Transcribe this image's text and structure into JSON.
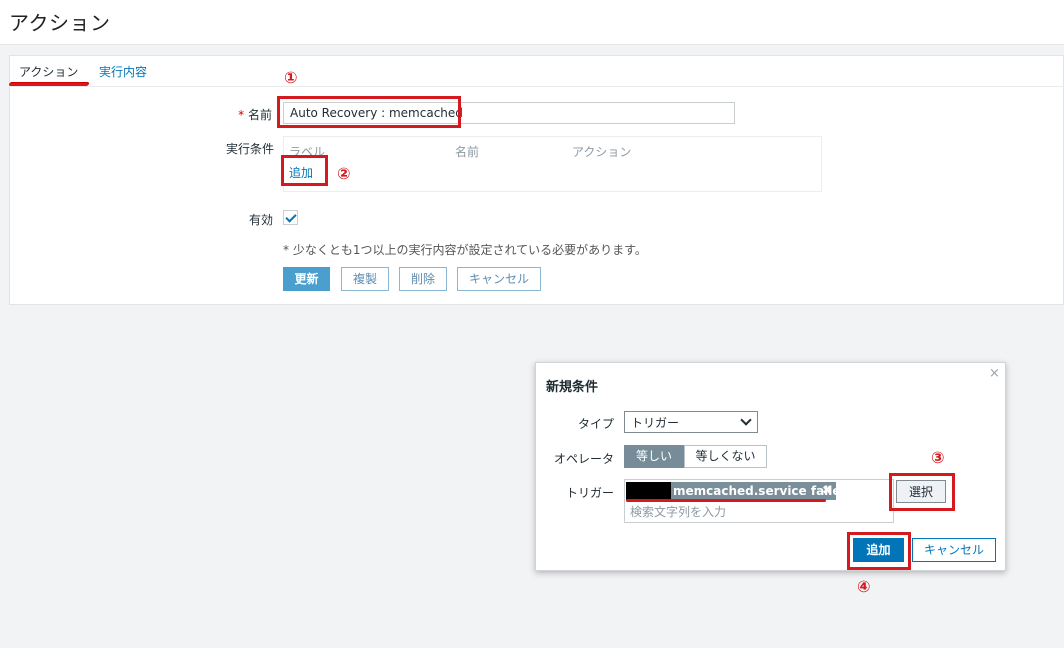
{
  "page": {
    "title": "アクション"
  },
  "tabs": [
    {
      "label": "アクション",
      "active": true
    },
    {
      "label": "実行内容",
      "active": false
    }
  ],
  "form": {
    "name_required_mark": "*",
    "name_label": "名前",
    "name_value": "Auto Recovery : memcached",
    "conditions_label": "実行条件",
    "conditions_columns": [
      "ラベル",
      "名前",
      "アクション"
    ],
    "conditions_add": "追加",
    "enabled_label": "有効",
    "enabled_checked": true,
    "note": "* 少なくとも1つ以上の実行内容が設定されている必要があります。",
    "buttons": {
      "update": "更新",
      "clone": "複製",
      "delete": "削除",
      "cancel": "キャンセル"
    }
  },
  "dialog": {
    "title": "新規条件",
    "close": "×",
    "type_label": "タイプ",
    "type_value": "トリガー",
    "operator_label": "オペレータ",
    "operator_options": [
      "等しい",
      "等しくない"
    ],
    "operator_selected": "等しい",
    "trigger_label": "トリガー",
    "trigger_chip": "memcached.service failed.",
    "trigger_chip_remove": "✖",
    "search_placeholder": "検索文字列を入力",
    "select_button": "選択",
    "add_button": "追加",
    "cancel_button": "キャンセル"
  },
  "annotations": {
    "m1": "①",
    "m2": "②",
    "m3": "③",
    "m4": "④"
  },
  "colors": {
    "accent": "#0275b8",
    "highlight_red": "#d4191f",
    "chip": "#7b8f9a"
  }
}
